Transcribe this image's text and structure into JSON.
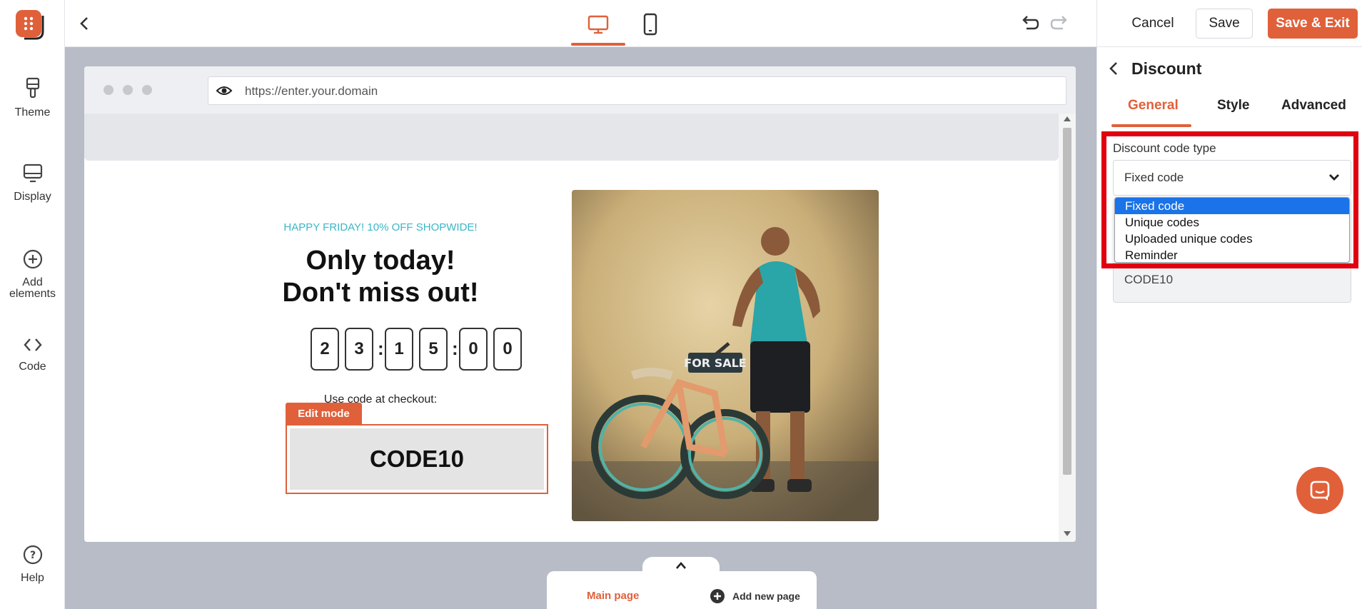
{
  "colors": {
    "accent": "#e0603a",
    "highlight": "#e1000f",
    "timer_teal": "#3bb6c6",
    "selected_option": "#1a73e8"
  },
  "sidebar": {
    "items": [
      {
        "label": "Theme",
        "icon": "paintbrush-icon"
      },
      {
        "label": "Display",
        "icon": "monitor-icon"
      },
      {
        "label": "Add elements",
        "icon": "plus-circle-icon"
      },
      {
        "label": "Code",
        "icon": "code-icon"
      }
    ],
    "help_label": "Help"
  },
  "toolbar": {
    "cancel_label": "Cancel",
    "save_label": "Save",
    "save_exit_label": "Save & Exit",
    "active_device": "desktop"
  },
  "preview": {
    "url": "https://enter.your.domain",
    "eyebrow": "HAPPY FRIDAY! 10% OFF SHOPWIDE!",
    "headline_line1": "Only today!",
    "headline_line2": "Don't miss out!",
    "timer_digits": [
      "2",
      "3",
      "1",
      "5",
      "0",
      "0"
    ],
    "use_code_text": "Use code at checkout:",
    "edit_mode_label": "Edit mode",
    "discount_code": "CODE10",
    "photo_sign": "FOR SALE"
  },
  "page_tabs": {
    "main_label": "Main page",
    "add_label": "Add new page"
  },
  "panel": {
    "title": "Discount",
    "tabs": [
      "General",
      "Style",
      "Advanced"
    ],
    "active_tab": "General",
    "field_label": "Discount code type",
    "selected_value": "Fixed code",
    "options": [
      "Fixed code",
      "Unique codes",
      "Uploaded unique codes",
      "Reminder"
    ],
    "code_value": "CODE10"
  }
}
